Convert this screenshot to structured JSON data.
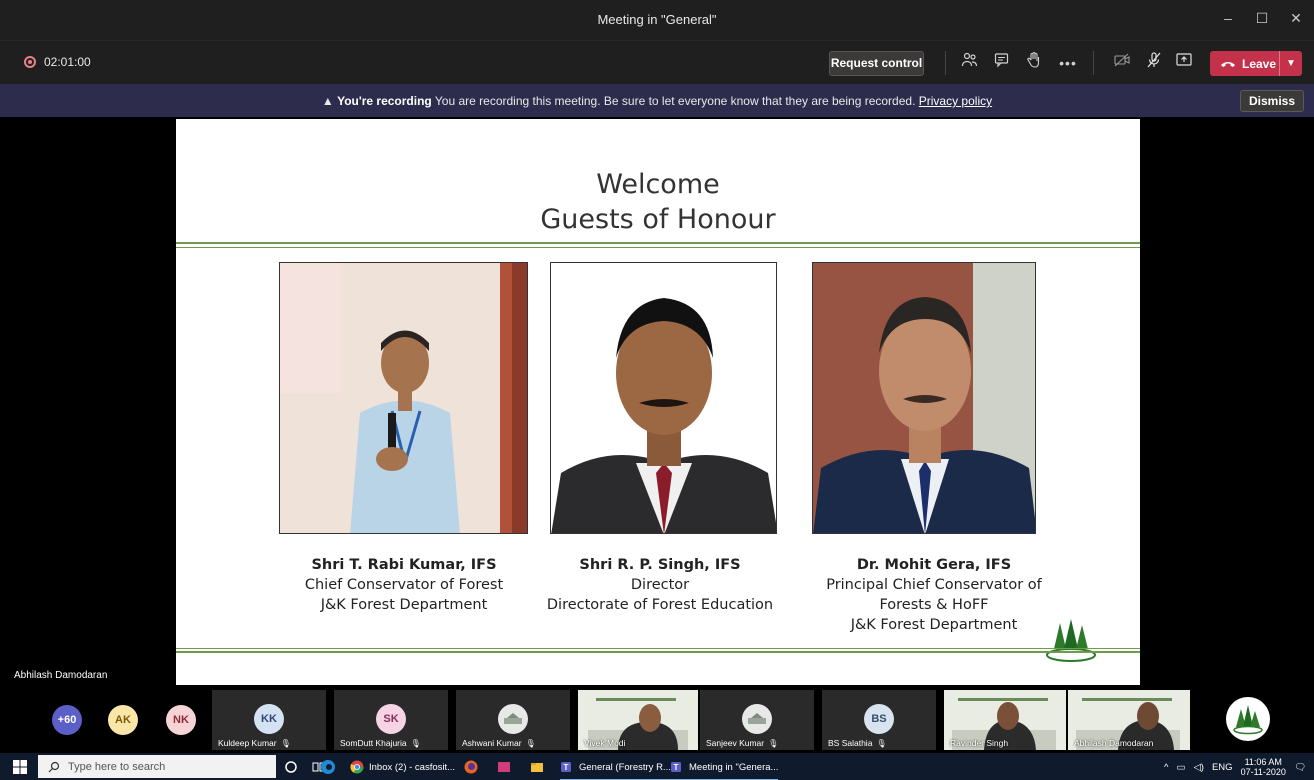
{
  "window": {
    "title": "Meeting in \"General\""
  },
  "toolbar": {
    "recording_time": "02:01:00",
    "request_control_label": "Request control",
    "leave_label": "Leave"
  },
  "banner": {
    "bold": "You're recording",
    "message": "You are recording this meeting. Be sure to let everyone know that they are being recorded.",
    "privacy_link": "Privacy policy",
    "dismiss_label": "Dismiss"
  },
  "slide": {
    "title_line1": "Welcome",
    "title_line2": "Guests of Honour",
    "guests": [
      {
        "name": "Shri T. Rabi Kumar, IFS",
        "line2": "Chief Conservator of Forest",
        "line3": "J&K Forest Department",
        "line4": ""
      },
      {
        "name": "Shri R. P. Singh, IFS",
        "line2": "Director",
        "line3": "Directorate of Forest Education",
        "line4": ""
      },
      {
        "name": "Dr. Mohit Gera, IFS",
        "line2": "Principal Chief Conservator of",
        "line3": "Forests & HoFF",
        "line4": "J&K Forest Department"
      }
    ],
    "presenter": "Abhilash Damodaran"
  },
  "participants": {
    "overflow": "+60",
    "avatars": [
      {
        "initials": "AK",
        "color": "#f9e6a8",
        "text": "#7a5b00"
      },
      {
        "initials": "NK",
        "color": "#f6d4d6",
        "text": "#8a2c3a"
      }
    ],
    "tiles": [
      {
        "initials": "KK",
        "name": "Kuldeep Kumar",
        "color": "#d4e2f3",
        "text": "#2d4a70"
      },
      {
        "initials": "SK",
        "name": "SomDutt Khajuria",
        "color": "#f6d4e6",
        "text": "#8a2c5a"
      },
      {
        "initials": "",
        "name": "Ashwani Kumar",
        "color": "#e8e8e8",
        "text": "#555"
      },
      {
        "initials": "",
        "name": "Sanjeev Kumar",
        "color": "#e8e8e8",
        "text": "#555"
      },
      {
        "initials": "BS",
        "name": "BS Salathia",
        "color": "#d8e3ef",
        "text": "#34506e"
      }
    ],
    "videos": [
      {
        "name": "Vivek Modi"
      },
      {
        "name": "Ravinder Singh"
      },
      {
        "name": "Abhilash Damodaran"
      }
    ]
  },
  "taskbar": {
    "search_placeholder": "Type here to search",
    "apps": [
      {
        "label": "Inbox (2) - casfosit..."
      },
      {
        "label": "General (Forestry R..."
      },
      {
        "label": "Meeting in \"Genera..."
      }
    ],
    "language": "ENG",
    "time": "11:06 AM",
    "date": "07-11-2020"
  },
  "colors": {
    "leave": "#c4314b",
    "banner": "#2d2c4d",
    "slide_rule": "#6d9c4b"
  }
}
